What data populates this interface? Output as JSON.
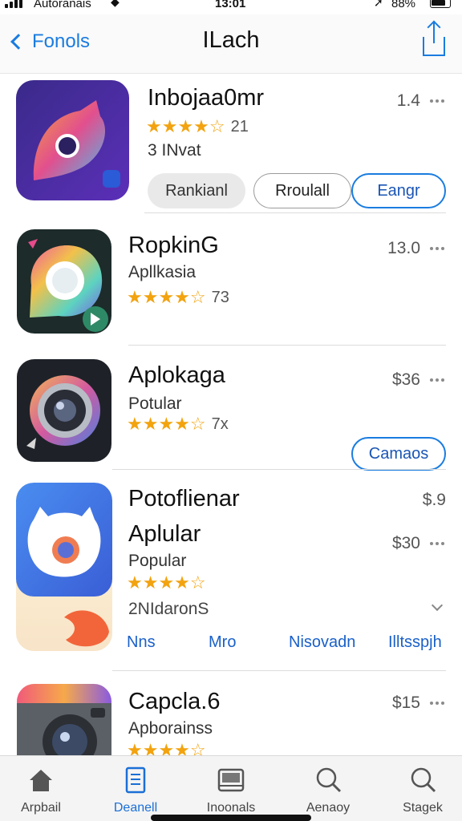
{
  "status_bar": {
    "carrier": "Autoranais",
    "time": "13:01",
    "battery": "88%"
  },
  "nav": {
    "back_label": "Fonols",
    "title": "ILach"
  },
  "apps": [
    {
      "name": "Inbojaa0mr",
      "stars": "★★★★☆",
      "rating": "21",
      "subtitle": "3 INvat",
      "price": "1.4",
      "buttons": [
        "Rankianl",
        "Rroulall",
        "Eangr"
      ]
    },
    {
      "name": "RopkinG",
      "subtitle": "Apllkasia",
      "stars": "★★★★☆",
      "rating": "73",
      "price": "13.0"
    },
    {
      "name": "Aplokaga",
      "subtitle": "Potular",
      "stars": "★★★★☆",
      "rating": "7x",
      "price": "$36",
      "button": "Camaos"
    },
    {
      "name": "Potoflienar",
      "price_top": "$.9",
      "name2": "Aplular",
      "subtitle": "Popular",
      "stars": "★★★★☆",
      "price": "$30",
      "reviews": "2NIdaronS",
      "links": [
        "Nns",
        "Mro",
        "Nisovadn",
        "Illtsspjh"
      ]
    },
    {
      "name": "Capcla.6",
      "subtitle": "Apborainss",
      "stars": "★★★★☆",
      "price": "$15"
    }
  ],
  "tabs": [
    {
      "label": "Arpbail",
      "icon": "home-icon",
      "active": false
    },
    {
      "label": "Deanell",
      "icon": "document-icon",
      "active": true
    },
    {
      "label": "Inoonals",
      "icon": "inbox-icon",
      "active": false
    },
    {
      "label": "Aenaoy",
      "icon": "search-icon",
      "active": false
    },
    {
      "label": "Stagek",
      "icon": "search-icon",
      "active": false
    }
  ],
  "colors": {
    "accent": "#1a7ce0",
    "star": "#f2a30f"
  }
}
